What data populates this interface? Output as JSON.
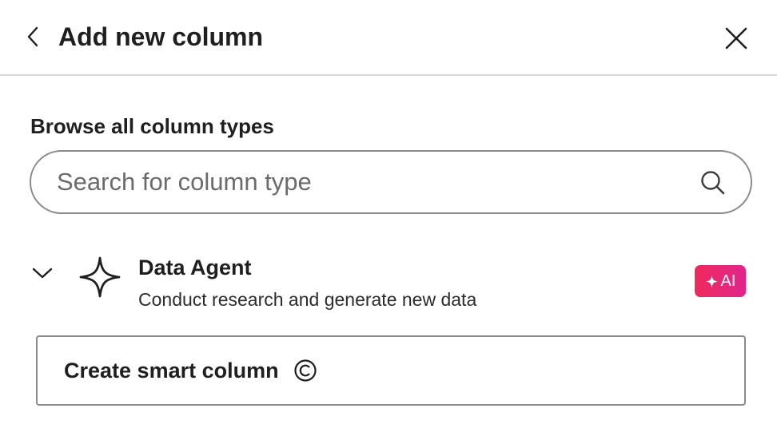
{
  "header": {
    "title": "Add new column",
    "back_icon": "chevron-left-icon",
    "close_icon": "close-icon"
  },
  "browse": {
    "title": "Browse all column types"
  },
  "search": {
    "value": "",
    "placeholder": "Search for column type",
    "icon": "search-icon"
  },
  "agent": {
    "title": "Data Agent",
    "description": "Conduct research and generate new data",
    "icon": "sparkle-icon",
    "expanded": true,
    "badge_label": "AI",
    "badge_color": "#f0295d"
  },
  "create_button": {
    "label": "Create smart column",
    "icon": "credits-icon"
  }
}
